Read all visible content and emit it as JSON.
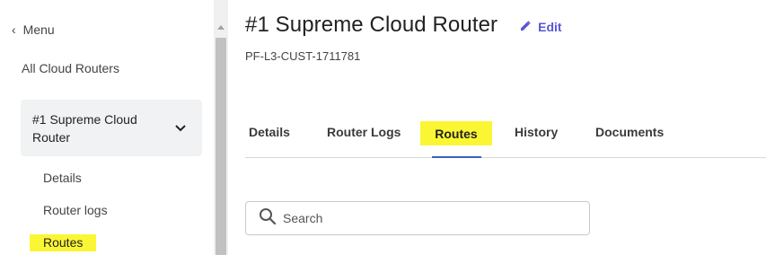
{
  "sidebar": {
    "back_label": "Menu",
    "all_routers_label": "All Cloud Routers",
    "router_name": "#1 Supreme Cloud Router",
    "sub_items": [
      {
        "label": "Details"
      },
      {
        "label": "Router logs"
      },
      {
        "label": "Routes"
      }
    ]
  },
  "header": {
    "title": "#1 Supreme Cloud Router",
    "edit_label": "Edit",
    "router_code": "PF-L3-CUST-1711781"
  },
  "tabs": [
    {
      "label": "Details"
    },
    {
      "label": "Router Logs"
    },
    {
      "label": "Routes",
      "active": true
    },
    {
      "label": "History"
    },
    {
      "label": "Documents"
    }
  ],
  "search": {
    "placeholder": "Search",
    "value": ""
  },
  "colors": {
    "accent": "#5b55d6",
    "highlight": "#fbf634",
    "tab_underline": "#3b63b8"
  },
  "icons": [
    "chevron-left-icon",
    "chevron-down-icon",
    "pencil-icon",
    "search-icon"
  ]
}
